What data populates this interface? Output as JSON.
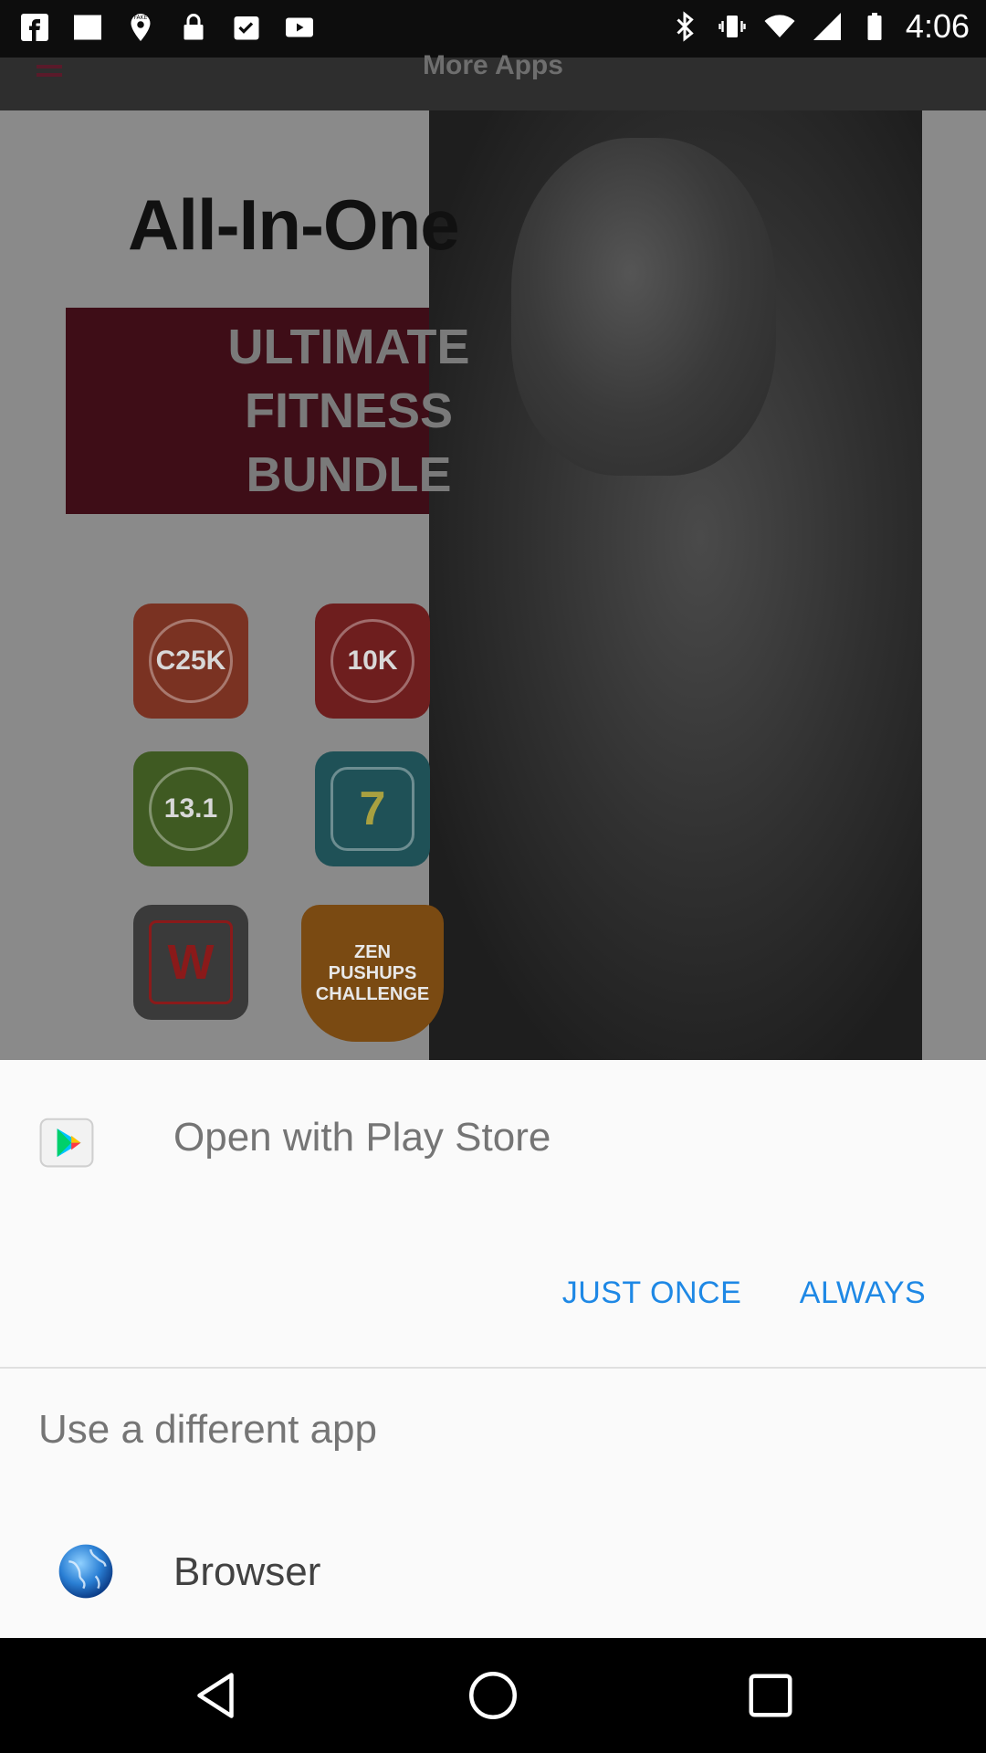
{
  "status_bar": {
    "time": "4:06",
    "left_icons": [
      "facebook-icon",
      "image-icon",
      "fake-gps-icon",
      "lock-icon",
      "check-clipboard-icon",
      "video-icon"
    ],
    "right_icons": [
      "bluetooth-icon",
      "vibrate-icon",
      "wifi-icon",
      "signal-icon",
      "battery-icon"
    ]
  },
  "app_bar": {
    "title": "More Apps",
    "menu_icon": "menu-icon"
  },
  "ad": {
    "headline": "All-In-One",
    "banner_lines": [
      "ULTIMATE",
      "FITNESS",
      "BUNDLE"
    ],
    "tiles": [
      {
        "label": "C25K",
        "color": "#7a3222"
      },
      {
        "label": "10K",
        "color": "#6e1e1e"
      },
      {
        "label": "13.1",
        "color": "#3f5a22"
      },
      {
        "label": "7",
        "color": "#1f5157"
      },
      {
        "label": "W",
        "color": "#3a3a3a"
      },
      {
        "label": "ZEN PUSHUPS CHALLENGE",
        "color": "#7a4a12"
      }
    ]
  },
  "dialog": {
    "title": "Open with Play Store",
    "just_once": "JUST ONCE",
    "always": "ALWAYS",
    "different_app": "Use a different app",
    "browser": "Browser",
    "accent_color": "#1e88e5"
  },
  "nav_bar": {
    "icons": [
      "back-icon",
      "home-icon",
      "recents-icon"
    ]
  }
}
